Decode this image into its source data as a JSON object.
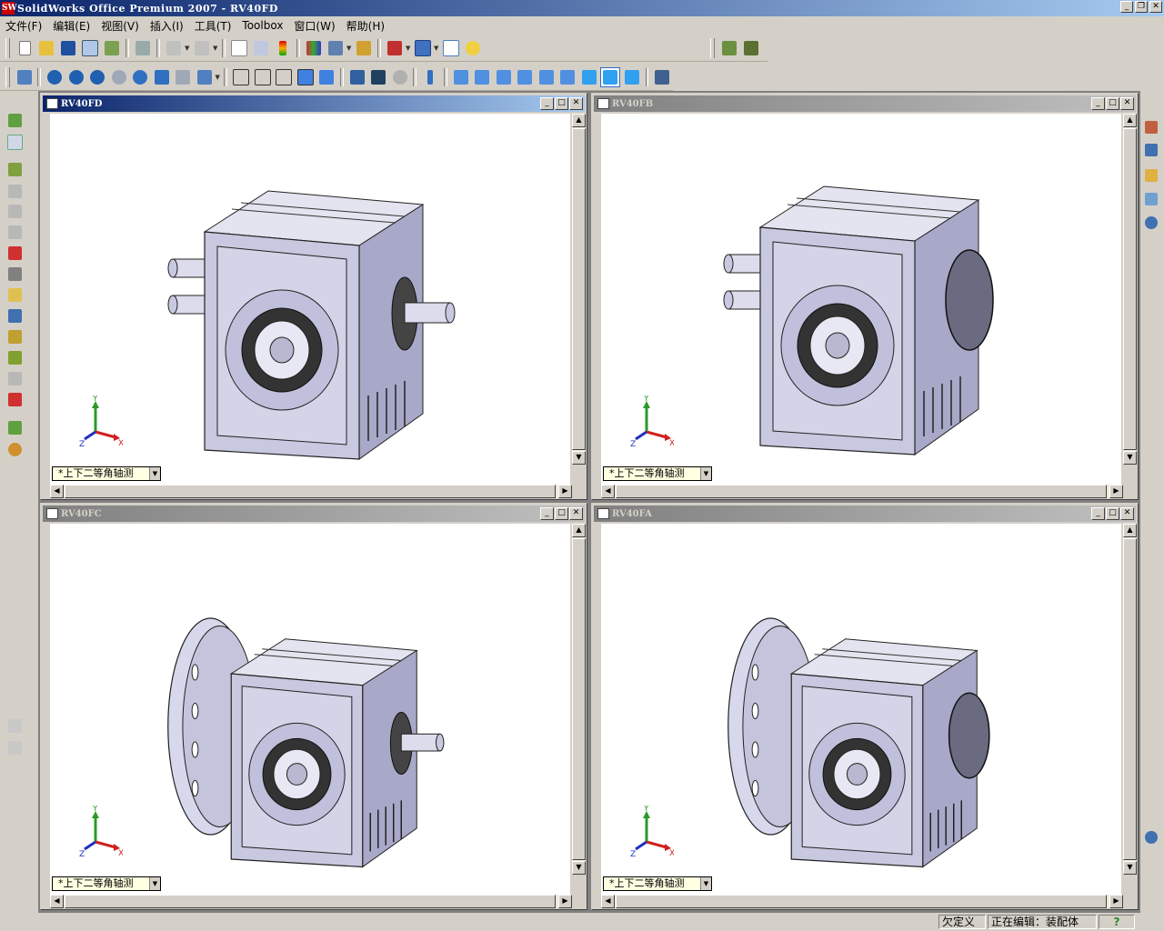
{
  "window": {
    "title": "SolidWorks Office Premium 2007 - RV40FD"
  },
  "menu": [
    {
      "label": "文件(F)"
    },
    {
      "label": "编辑(E)"
    },
    {
      "label": "视图(V)"
    },
    {
      "label": "插入(I)"
    },
    {
      "label": "工具(T)"
    },
    {
      "label": "Toolbox"
    },
    {
      "label": "窗口(W)"
    },
    {
      "label": "帮助(H)"
    }
  ],
  "documents": [
    {
      "name": "RV40FD",
      "view": "*上下二等角轴测",
      "active": true,
      "variant": "shaft"
    },
    {
      "name": "RV40FB",
      "view": "*上下二等角轴测",
      "active": false,
      "variant": "cover"
    },
    {
      "name": "RV40FC",
      "view": "*上下二等角轴测",
      "active": false,
      "variant": "flange-shaft"
    },
    {
      "name": "RV40FA",
      "view": "*上下二等角轴测",
      "active": false,
      "variant": "flange-cover"
    }
  ],
  "triad": {
    "x": "X",
    "y": "Y",
    "z": "Z"
  },
  "status": {
    "defined": "欠定义",
    "editing": "正在编辑：装配体",
    "help": "?"
  },
  "colors": {
    "titlebar_start": "#0a246a",
    "titlebar_end": "#a6caf0",
    "model": "#c8c8e0"
  }
}
